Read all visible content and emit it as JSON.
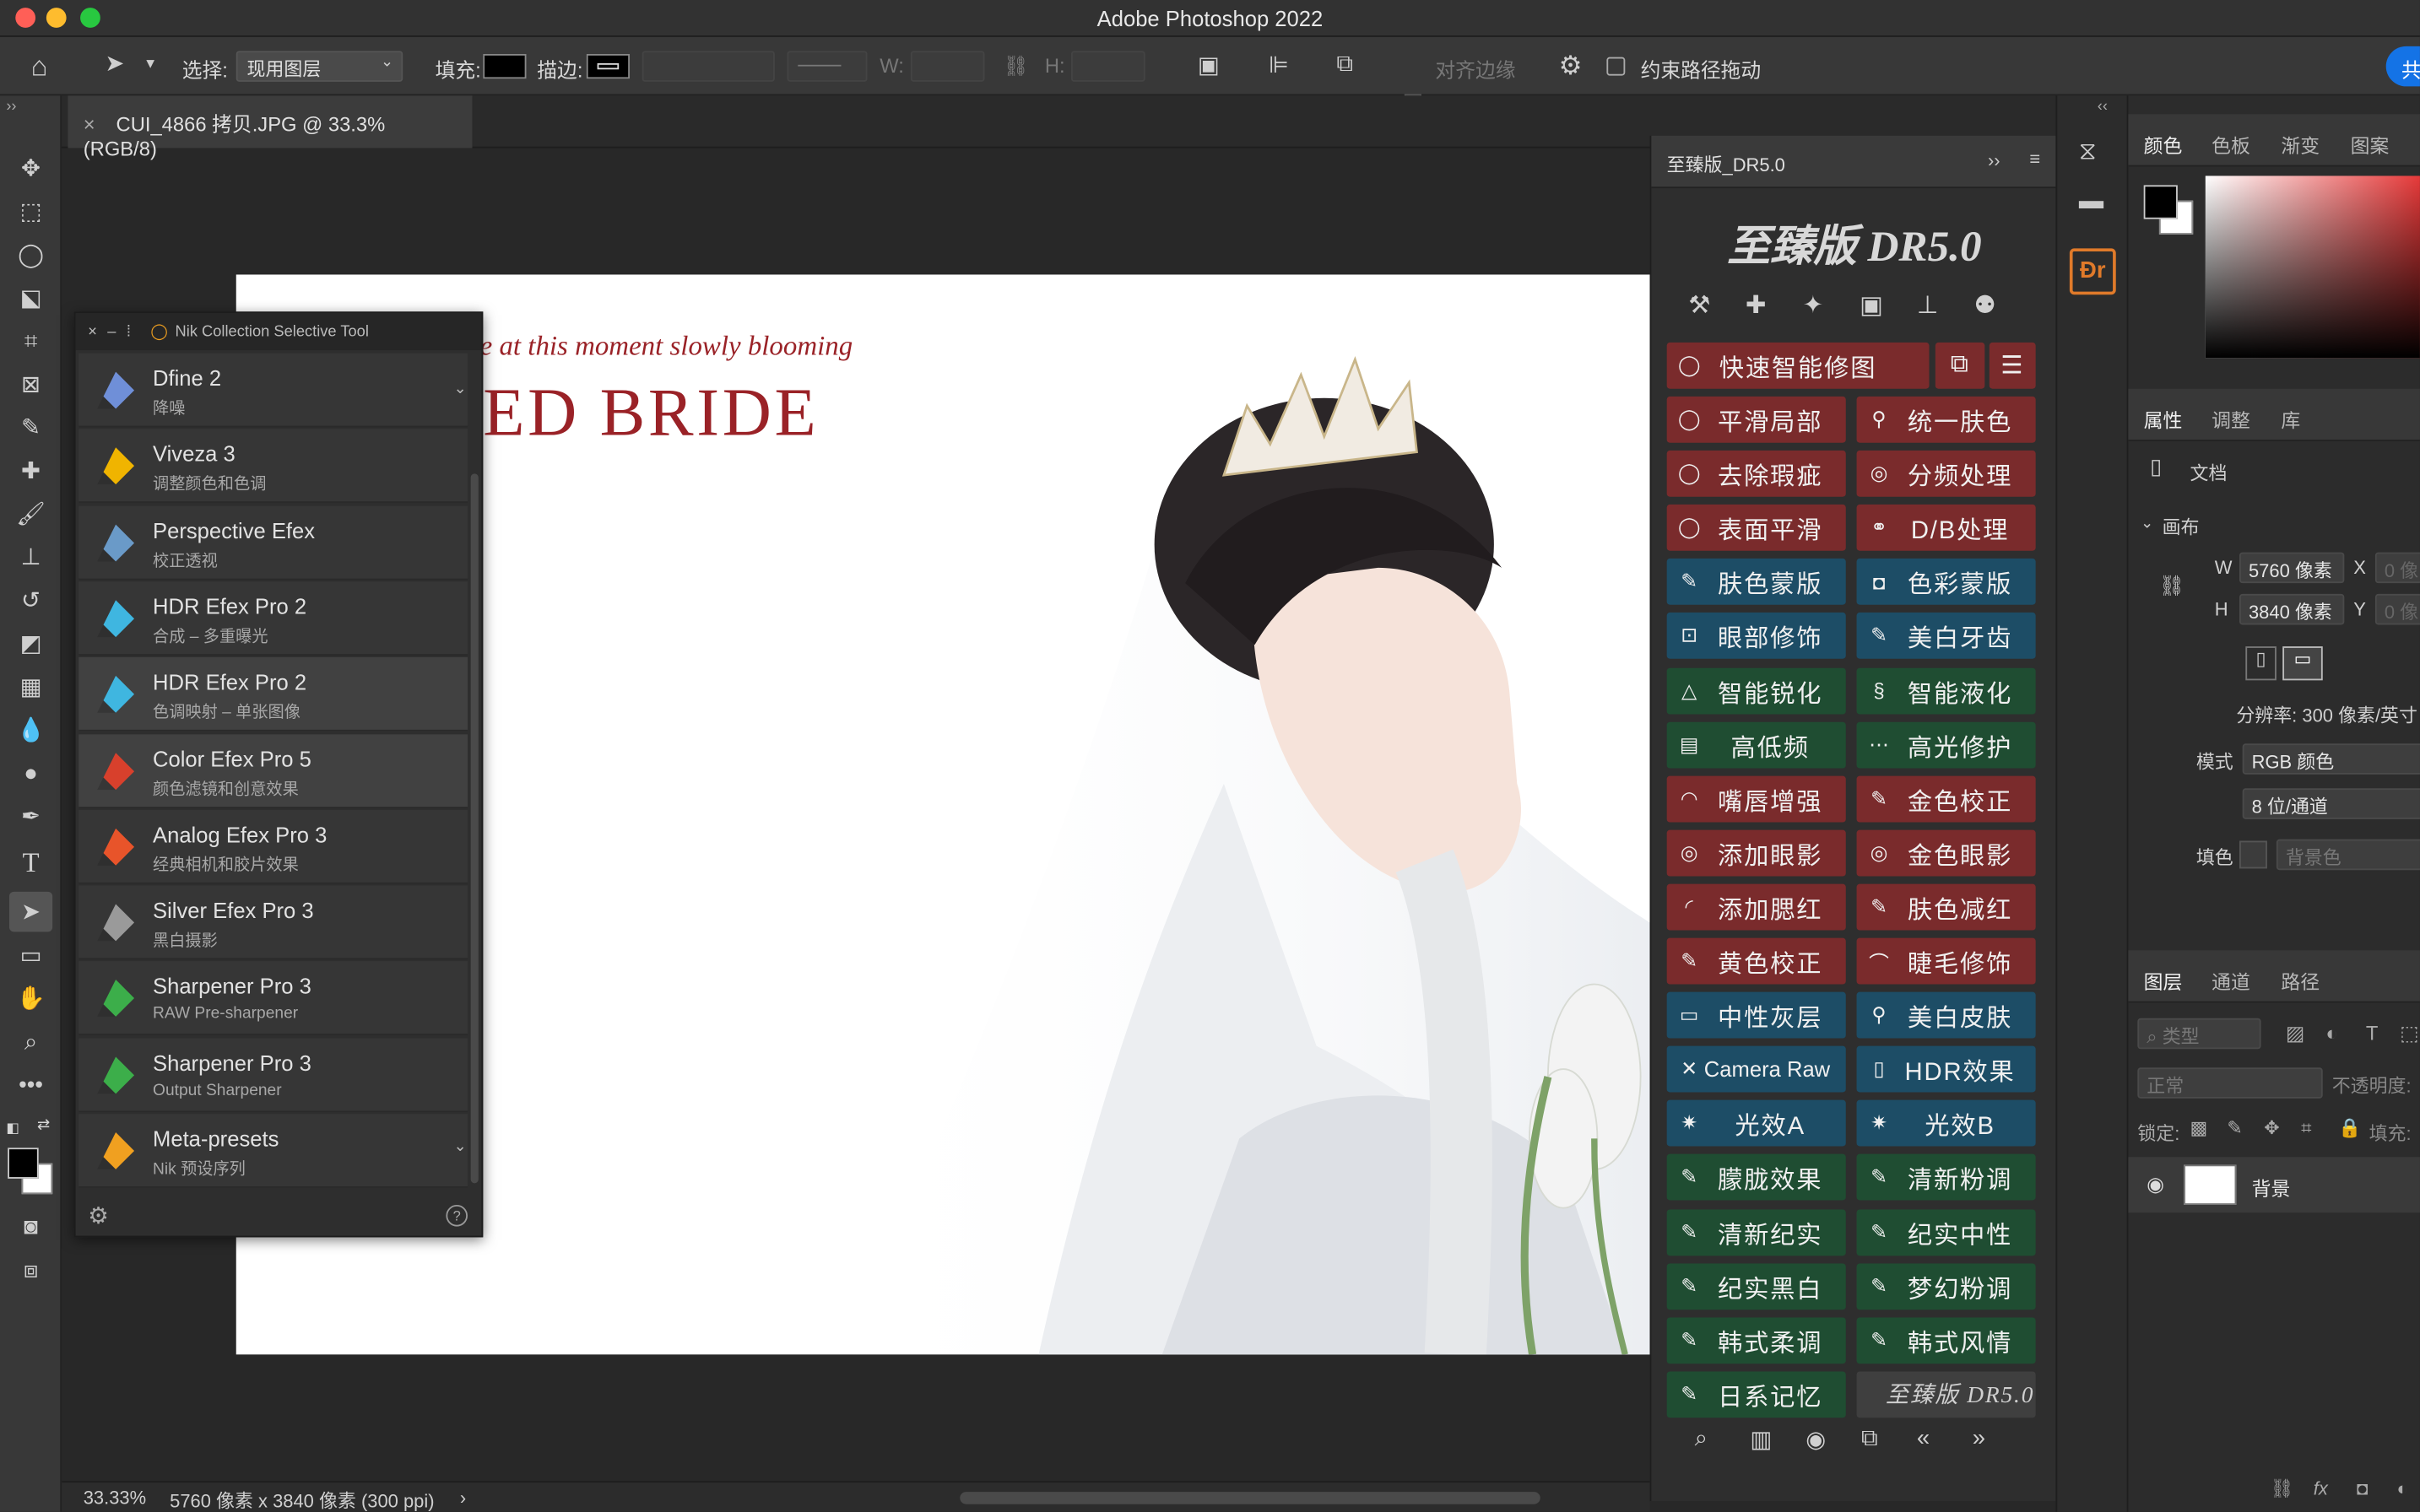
{
  "app": {
    "title": "Adobe Photoshop 2022"
  },
  "options_bar": {
    "select_label": "选择:",
    "select_value": "现用图层",
    "fill_label": "填充:",
    "stroke_label": "描边:",
    "w_label": "W:",
    "h_label": "H:",
    "align_edges_label": "对齐边缘",
    "constrain_path_label": "约束路径拖动",
    "share_button_label": "共"
  },
  "document": {
    "tab_title": "CUI_4866 拷贝.JPG @ 33.3%(RGB/8)",
    "canvas_script_text": "e at this moment slowly blooming",
    "canvas_title_text": "ED BRIDE"
  },
  "nik_panel": {
    "title": "Nik Collection Selective Tool",
    "items": [
      {
        "name": "Dfine 2",
        "desc": "降噪",
        "color": "#6f8fd8"
      },
      {
        "name": "Viveza 3",
        "desc": "调整颜色和色调",
        "color": "#f0b400"
      },
      {
        "name": "Perspective Efex",
        "desc": "校正透视",
        "color": "#6a9ac8"
      },
      {
        "name": "HDR Efex Pro 2",
        "desc": "合成 – 多重曝光",
        "color": "#3fb6e0"
      },
      {
        "name": "HDR Efex Pro 2",
        "desc": "色调映射 – 单张图像",
        "color": "#3fb6e0"
      },
      {
        "name": "Color Efex Pro 5",
        "desc": "颜色滤镜和创意效果",
        "color": "#d8402c"
      },
      {
        "name": "Analog Efex Pro 3",
        "desc": "经典相机和胶片效果",
        "color": "#e8542a"
      },
      {
        "name": "Silver Efex Pro 3",
        "desc": "黑白摄影",
        "color": "#9a9a9a"
      },
      {
        "name": "Sharpener Pro 3",
        "desc": "RAW Pre-sharpener",
        "color": "#3cae4a"
      },
      {
        "name": "Sharpener Pro 3",
        "desc": "Output Sharpener",
        "color": "#3cae4a"
      },
      {
        "name": "Meta-presets",
        "desc": "Nik 预设序列",
        "color": "#f0a020"
      }
    ]
  },
  "dr_panel": {
    "tab_label": "至臻版_DR5.0",
    "logo_text": "至臻版 DR5.0",
    "top_button": "快速智能修图",
    "rows": [
      [
        "平滑局部",
        "统一肤色"
      ],
      [
        "去除瑕疵",
        "分频处理"
      ],
      [
        "表面平滑",
        "D/B处理"
      ],
      [
        "肤色蒙版",
        "色彩蒙版"
      ],
      [
        "眼部修饰",
        "美白牙齿"
      ],
      [
        "智能锐化",
        "智能液化"
      ],
      [
        "高低频",
        "高光修护"
      ],
      [
        "嘴唇增强",
        "金色校正"
      ],
      [
        "添加眼影",
        "金色眼影"
      ],
      [
        "添加腮红",
        "肤色减红"
      ],
      [
        "黄色校正",
        "睫毛修饰"
      ],
      [
        "中性灰层",
        "美白皮肤"
      ],
      [
        "Camera Raw",
        "HDR效果"
      ],
      [
        "光效A",
        "光效B"
      ],
      [
        "朦胧效果",
        "清新粉调"
      ],
      [
        "清新纪实",
        "纪实中性"
      ],
      [
        "纪实黑白",
        "梦幻粉调"
      ],
      [
        "韩式柔调",
        "韩式风情"
      ],
      [
        "日系记忆",
        "至臻版 DR5.0"
      ]
    ],
    "row_colors": [
      "red",
      "red",
      "red",
      "blue",
      "blue",
      "green",
      "green",
      "red",
      "red",
      "red",
      "red",
      "blue",
      "blue",
      "blue",
      "green",
      "green",
      "green",
      "green",
      "green"
    ]
  },
  "right_panel": {
    "color_tabs": [
      "颜色",
      "色板",
      "渐变",
      "图案"
    ],
    "props_tabs": [
      "属性",
      "调整",
      "库"
    ],
    "doc_label": "文档",
    "canvas_section": "画布",
    "w_label": "W",
    "w_value": "5760 像素",
    "h_label": "H",
    "h_value": "3840 像素",
    "x_label": "X",
    "x_value": "0 像",
    "y_label": "Y",
    "y_value": "0 像",
    "resolution": "分辨率: 300 像素/英寸",
    "mode_label": "模式",
    "mode_value": "RGB 颜色",
    "depth_value": "8 位/通道",
    "fill_label": "填色",
    "fill_value": "背景色",
    "layers_tabs": [
      "图层",
      "通道",
      "路径"
    ],
    "layer_filter": "类型",
    "blend_mode": "正常",
    "opacity_label": "不透明度:",
    "lock_label": "锁定:",
    "fill2_label": "填充:",
    "layer_name": "背景"
  },
  "status": {
    "zoom": "33.33%",
    "info": "5760 像素 x 3840 像素 (300 ppi)"
  },
  "colors": {
    "dr_red": "#7a2b2c",
    "dr_blue": "#1d4d66",
    "dr_green": "#1f4d32",
    "accent_blue": "#1473e6",
    "canvas_title_red": "#9a2227"
  }
}
